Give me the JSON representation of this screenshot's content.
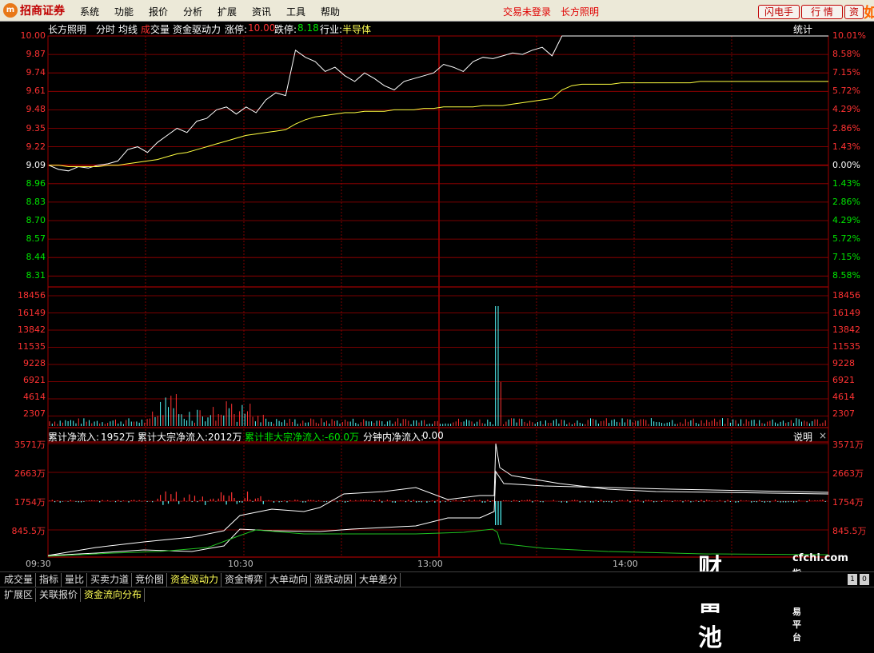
{
  "app": {
    "logo_mark": "m",
    "logo_text": "招商证券",
    "menus": [
      "系统",
      "功能",
      "报价",
      "分析",
      "扩展",
      "资讯",
      "工具",
      "帮助"
    ],
    "login_status": "交易未登录",
    "stock_name_top": "长方照明",
    "buttons": [
      "闪电手",
      "行 情",
      "资"
    ],
    "right_edge_char": "如"
  },
  "header": {
    "stock": "长方照明",
    "mode": "分时",
    "avg": "均线",
    "vol_char1": "成",
    "vol_char2": "交量",
    "indicator": "资金驱动力",
    "limit_up_label": "涨停:",
    "limit_up": "10.00",
    "limit_down_label": "跌停:",
    "limit_down": "8.18",
    "industry_label": "行业:",
    "industry": "半导体",
    "stats": "统计"
  },
  "price_axis": {
    "left": [
      "10.00",
      "9.87",
      "9.74",
      "9.61",
      "9.48",
      "9.35",
      "9.22",
      "9.09",
      "8.96",
      "8.83",
      "8.70",
      "8.57",
      "8.44",
      "8.31"
    ],
    "right": [
      "10.01%",
      "8.58%",
      "7.15%",
      "5.72%",
      "4.29%",
      "2.86%",
      "1.43%",
      "0.00%",
      "1.43%",
      "2.86%",
      "4.29%",
      "5.72%",
      "7.15%",
      "8.58%"
    ]
  },
  "volume_axis": {
    "labels": [
      "18456",
      "16149",
      "13842",
      "11535",
      "9228",
      "6921",
      "4614",
      "2307"
    ]
  },
  "flow_header": {
    "cum_net_label": "累计净流入:",
    "cum_net": "1952万",
    "block_net_label": "累计大宗净流入:",
    "block_net": "2012万",
    "nonblock_net_label": "累计非大宗净流入:",
    "nonblock_net": "-60.0万",
    "minute_net_label": "分钟内净流入:",
    "minute_net": "0.00",
    "explain": "说明",
    "close": "×"
  },
  "flow_axis": {
    "labels": [
      "3571万",
      "2663万",
      "1754万",
      "845.5万"
    ]
  },
  "time_axis": [
    "09:30",
    "10:30",
    "13:00",
    "14:00"
  ],
  "tabs_row1": [
    "成交量",
    "指标",
    "量比",
    "买卖力道",
    "竞价图",
    "资金驱动力",
    "资金博弈",
    "大单动向",
    "涨跌动因",
    "大单差分"
  ],
  "tabs_row1_active": "资金驱动力",
  "tabs_row2": [
    "扩展区",
    "关联报价",
    "资金流向分布"
  ],
  "tabs_row2_active": "资金流向分布",
  "scroll": {
    "left": "1",
    "right": "0"
  },
  "watermark": {
    "big": "财富池",
    "url": "cfchi.com",
    "sub": "指标交易平台"
  },
  "colors": {
    "grid": "#a00000",
    "price": "#ffffff",
    "avg": "#ffff40",
    "up": "#ff3232",
    "down": "#00e600",
    "flow_green": "#20c020",
    "bar_cyan": "#54ffff"
  },
  "chart_data": {
    "type": "line",
    "price_series": [
      9.09,
      9.06,
      9.05,
      9.08,
      9.07,
      9.09,
      9.1,
      9.12,
      9.2,
      9.22,
      9.18,
      9.25,
      9.3,
      9.35,
      9.32,
      9.4,
      9.42,
      9.48,
      9.5,
      9.45,
      9.5,
      9.46,
      9.55,
      9.6,
      9.58,
      9.9,
      9.85,
      9.82,
      9.75,
      9.78,
      9.72,
      9.68,
      9.74,
      9.7,
      9.65,
      9.62,
      9.68,
      9.7,
      9.72,
      9.74,
      9.8,
      9.78,
      9.75,
      9.82,
      9.85,
      9.84,
      9.86,
      9.88,
      9.87,
      9.9,
      9.92,
      9.86,
      10.0,
      10.0,
      10.0,
      10.0,
      10.0,
      10.0,
      10.0,
      10.0,
      10.0,
      10.0,
      10.0,
      10.0,
      10.0,
      10.0,
      10.0,
      10.0,
      10.0,
      10.0,
      10.0,
      10.0,
      10.0,
      10.0,
      10.0,
      10.0,
      10.0,
      10.0,
      10.0,
      10.0
    ],
    "avg_series": [
      9.09,
      9.09,
      9.08,
      9.08,
      9.08,
      9.08,
      9.09,
      9.09,
      9.1,
      9.11,
      9.12,
      9.13,
      9.15,
      9.17,
      9.18,
      9.2,
      9.22,
      9.24,
      9.26,
      9.28,
      9.3,
      9.31,
      9.32,
      9.33,
      9.34,
      9.38,
      9.41,
      9.43,
      9.44,
      9.45,
      9.46,
      9.46,
      9.47,
      9.47,
      9.47,
      9.48,
      9.48,
      9.48,
      9.49,
      9.49,
      9.5,
      9.5,
      9.5,
      9.5,
      9.51,
      9.51,
      9.51,
      9.52,
      9.53,
      9.54,
      9.55,
      9.56,
      9.62,
      9.65,
      9.66,
      9.66,
      9.66,
      9.66,
      9.67,
      9.67,
      9.67,
      9.67,
      9.67,
      9.67,
      9.67,
      9.67,
      9.68,
      9.68,
      9.68,
      9.68,
      9.68,
      9.68,
      9.68,
      9.68,
      9.68,
      9.68,
      9.68,
      9.68,
      9.68,
      9.68
    ],
    "price_range": [
      8.18,
      10.0
    ],
    "prev_close": 9.09
  }
}
